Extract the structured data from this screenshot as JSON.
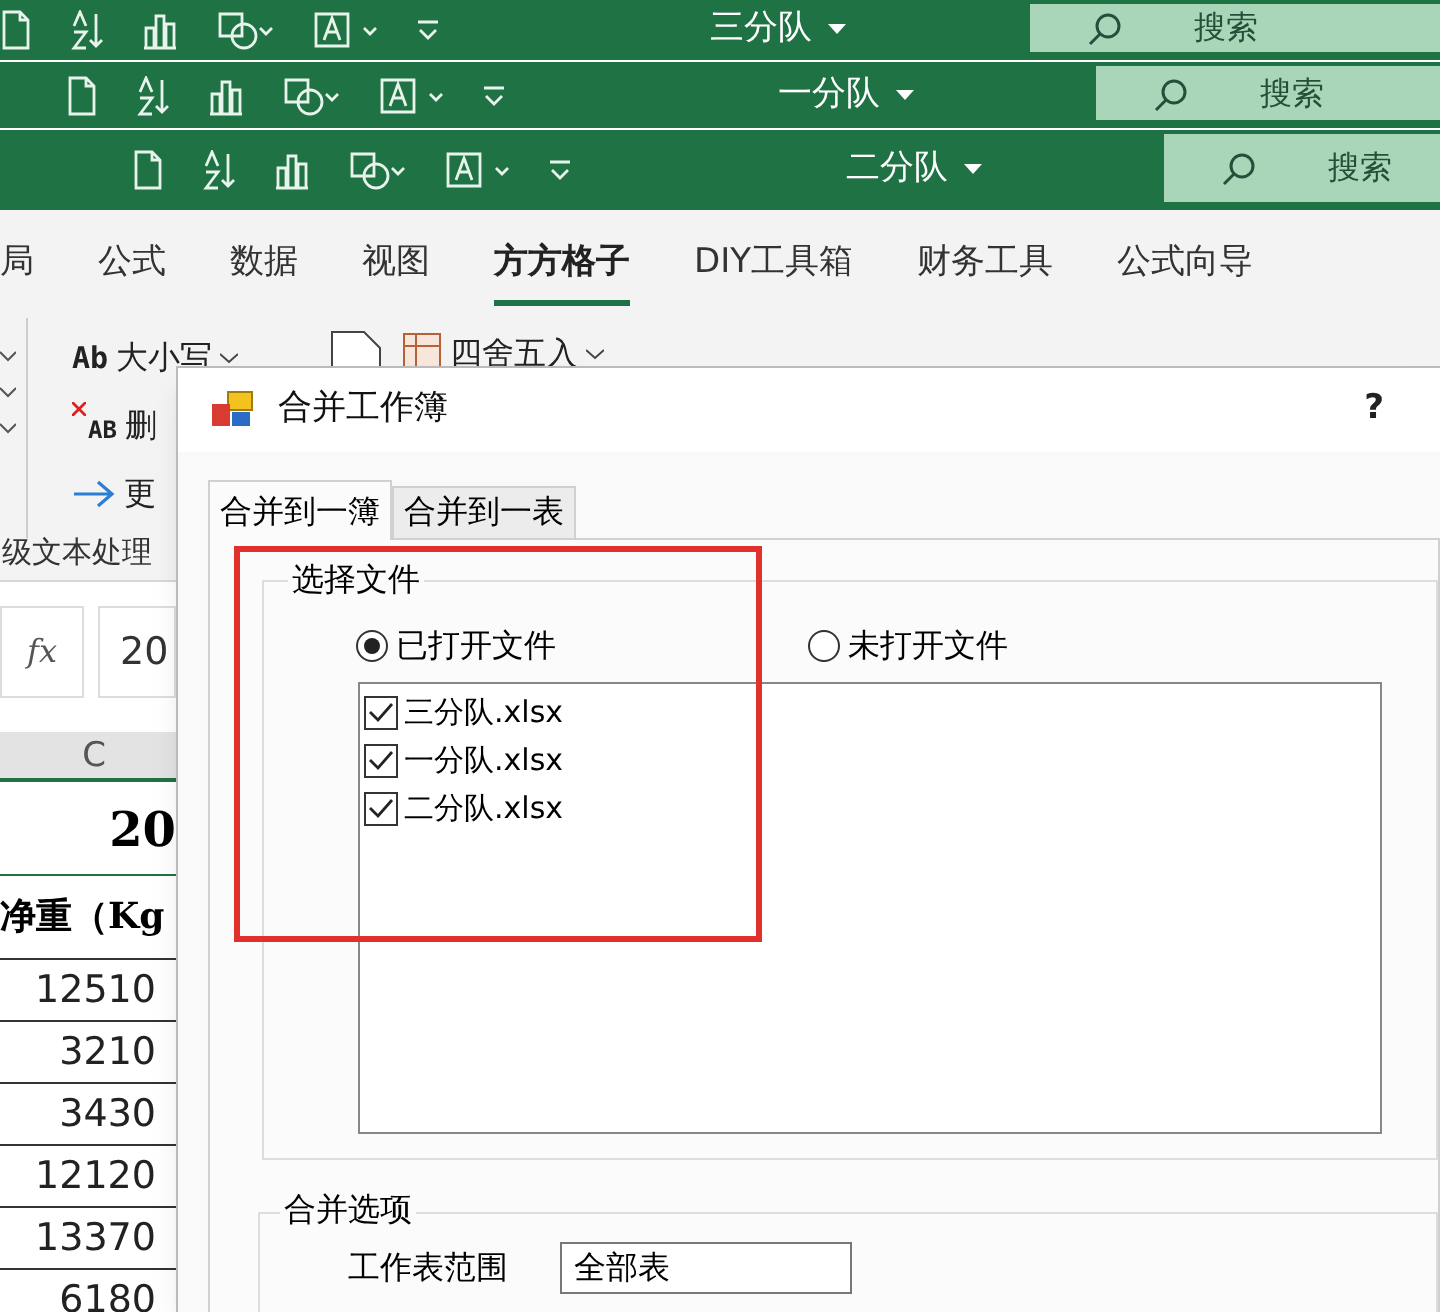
{
  "title_bars": [
    {
      "title": "三分队",
      "search": {
        "placeholder": "搜索"
      }
    },
    {
      "title": "一分队",
      "search": {
        "placeholder": "搜索"
      }
    },
    {
      "title": "二分队",
      "search": {
        "placeholder": "搜索"
      }
    }
  ],
  "ribbon": {
    "tabs": [
      {
        "label": "局",
        "selected": false
      },
      {
        "label": "公式",
        "selected": false
      },
      {
        "label": "数据",
        "selected": false
      },
      {
        "label": "视图",
        "selected": false
      },
      {
        "label": "方方格子",
        "selected": true
      },
      {
        "label": "DIY工具箱",
        "selected": false
      },
      {
        "label": "财务工具",
        "selected": false
      },
      {
        "label": "公式向导",
        "selected": false
      }
    ],
    "text_tools": [
      {
        "kind": "case",
        "icon_text": "Ab",
        "label": "大小写",
        "dropdown": true
      },
      {
        "kind": "delete",
        "icon_text": "AB",
        "label": "删",
        "dropdown": false
      },
      {
        "kind": "more",
        "label": "更",
        "dropdown": false
      }
    ],
    "group_label": "级文本处理",
    "round_button": {
      "label": "四舍五入",
      "dropdown": true
    }
  },
  "sheet": {
    "fx_label": "fx",
    "formula": "20",
    "column": "C",
    "title_cell": "20",
    "header_cell": "净重（Kg",
    "values": [
      "12510",
      "3210",
      "3430",
      "12120",
      "13370",
      "6180"
    ]
  },
  "dialog": {
    "title": "合并工作簿",
    "help": "?",
    "tabs": [
      {
        "label": "合并到一簿",
        "selected": true
      },
      {
        "label": "合并到一表",
        "selected": false
      }
    ],
    "file_group": {
      "title": "选择文件",
      "radios": [
        {
          "label": "已打开文件",
          "selected": true
        },
        {
          "label": "未打开文件",
          "selected": false
        }
      ],
      "files": [
        {
          "name": "三分队.xlsx",
          "checked": true
        },
        {
          "name": "一分队.xlsx",
          "checked": true
        },
        {
          "name": "二分队.xlsx",
          "checked": true
        }
      ]
    },
    "options_group": {
      "title": "合并选项",
      "range_label": "工作表范围",
      "range_value": "全部表"
    }
  }
}
